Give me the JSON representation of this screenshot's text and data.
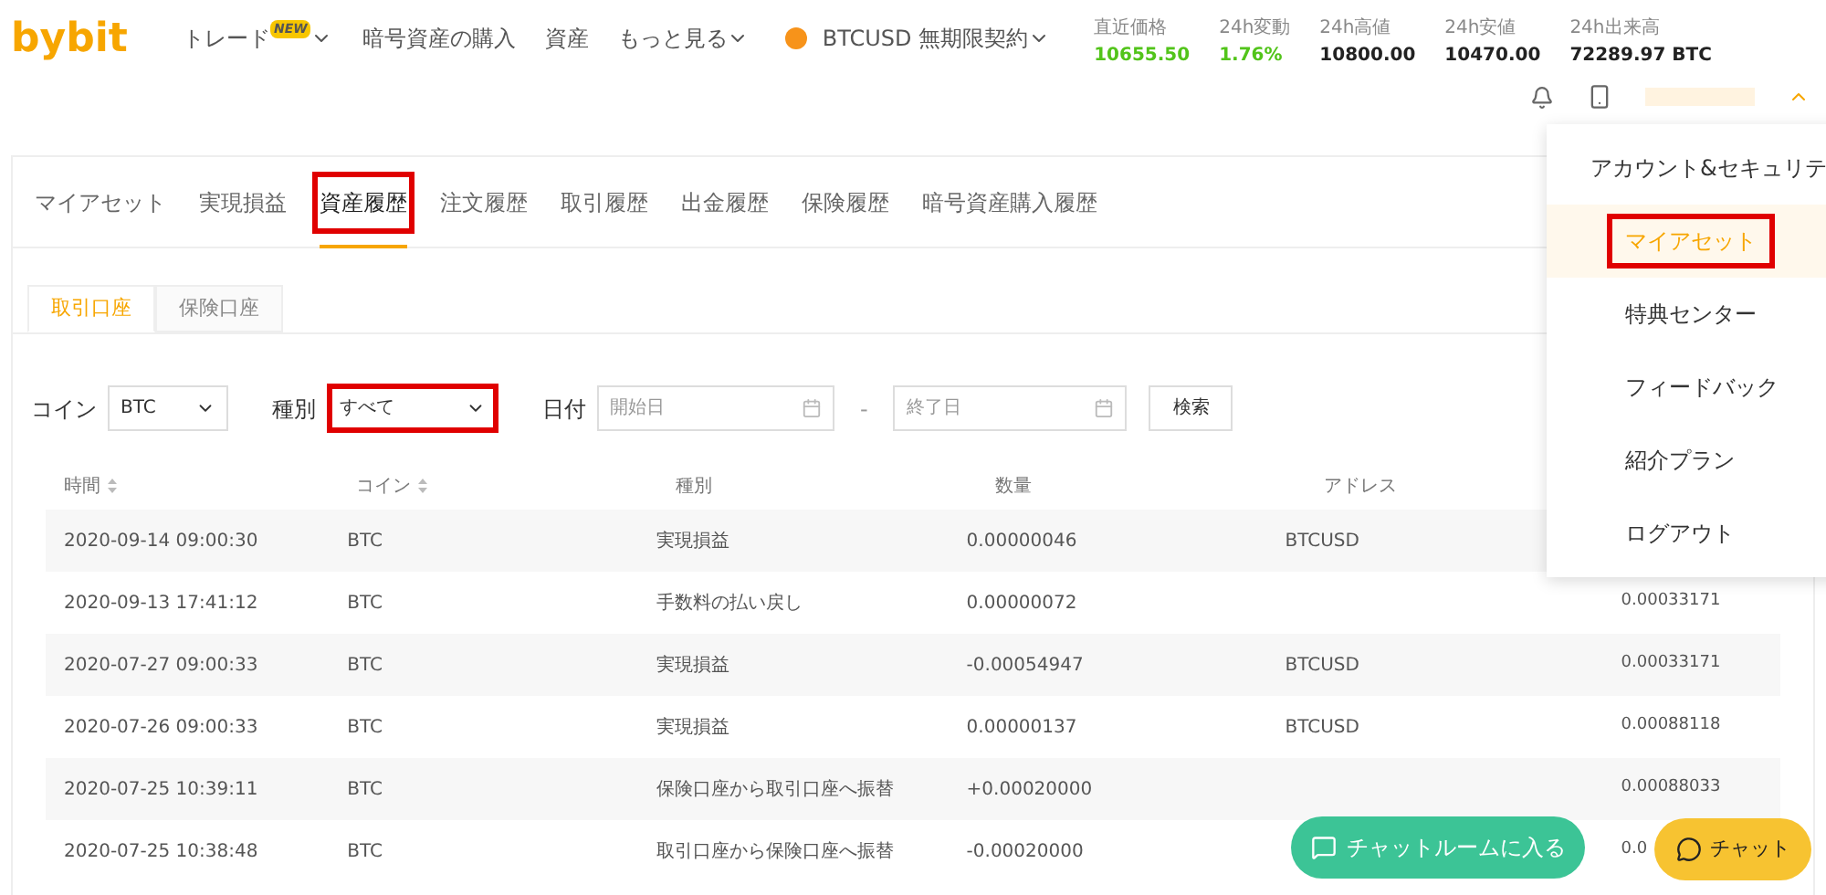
{
  "header": {
    "logo": "bybit",
    "nav": [
      {
        "label": "トレード",
        "badge": "NEW",
        "caret": true
      },
      {
        "label": "暗号資産の購入",
        "caret": false
      },
      {
        "label": "資産",
        "caret": false
      },
      {
        "label": "もっと見る",
        "caret": true
      }
    ],
    "contract": "BTCUSD 無期限契約",
    "stats": [
      {
        "label": "直近価格",
        "value": "10655.50",
        "color": "#52c41a"
      },
      {
        "label": "24h変動",
        "value": "1.76%",
        "color": "#52c41a"
      },
      {
        "label": "24h高値",
        "value": "10800.00",
        "color": "#222222"
      },
      {
        "label": "24h安値",
        "value": "10470.00",
        "color": "#222222"
      },
      {
        "label": "24h出来高",
        "value": "72289.97 BTC",
        "color": "#222222"
      }
    ]
  },
  "tabs": [
    {
      "label": "マイアセット",
      "selected": false,
      "highlighted": false
    },
    {
      "label": "実現損益",
      "selected": false,
      "highlighted": false
    },
    {
      "label": "資産履歴",
      "selected": true,
      "highlighted": true
    },
    {
      "label": "注文履歴",
      "selected": false,
      "highlighted": false
    },
    {
      "label": "取引履歴",
      "selected": false,
      "highlighted": false
    },
    {
      "label": "出金履歴",
      "selected": false,
      "highlighted": false
    },
    {
      "label": "保険履歴",
      "selected": false,
      "highlighted": false
    },
    {
      "label": "暗号資産購入履歴",
      "selected": false,
      "highlighted": false
    }
  ],
  "subtabs": [
    {
      "label": "取引口座",
      "selected": true
    },
    {
      "label": "保険口座",
      "selected": false
    }
  ],
  "filters": {
    "coin_label": "コイン",
    "coin": "BTC",
    "type_label": "種別",
    "type": "すべて",
    "type_highlighted": true,
    "date_label": "日付",
    "start_placeholder": "開始日",
    "separator": "-",
    "end_placeholder": "終了日",
    "search_button": "検索"
  },
  "table": {
    "columns": [
      {
        "label": "時間",
        "sortable": true
      },
      {
        "label": "コイン",
        "sortable": true
      },
      {
        "label": "種別",
        "sortable": false
      },
      {
        "label": "数量",
        "sortable": false
      },
      {
        "label": "アドレス",
        "sortable": false
      }
    ],
    "rows": [
      [
        "2020-09-14 09:00:30",
        "BTC",
        "実現損益",
        "0.00000046",
        "BTCUSD",
        ""
      ],
      [
        "2020-09-13 17:41:12",
        "BTC",
        "手数料の払い戻し",
        "0.00000072",
        "",
        "0.00033171"
      ],
      [
        "2020-07-27 09:00:33",
        "BTC",
        "実現損益",
        "-0.00054947",
        "BTCUSD",
        "0.00033171"
      ],
      [
        "2020-07-26 09:00:33",
        "BTC",
        "実現損益",
        "0.00000137",
        "BTCUSD",
        "0.00088118"
      ],
      [
        "2020-07-25 10:39:11",
        "BTC",
        "保険口座から取引口座へ振替",
        "+0.00020000",
        "",
        "0.00088033"
      ],
      [
        "2020-07-25 10:38:48",
        "BTC",
        "取引口座から保険口座へ振替",
        "-0.00020000",
        "",
        "0.0"
      ]
    ]
  },
  "user_menu": [
    {
      "label": "アカウント&セキュリテ",
      "selected": false,
      "highlighted": false
    },
    {
      "label": "マイアセット",
      "selected": true,
      "highlighted": true
    },
    {
      "label": "特典センター",
      "selected": false,
      "highlighted": false
    },
    {
      "label": "フィードバック",
      "selected": false,
      "highlighted": false
    },
    {
      "label": "紹介プラン",
      "selected": false,
      "highlighted": false
    },
    {
      "label": "ログアウト",
      "selected": false,
      "highlighted": false
    }
  ],
  "chat_room_button": "チャットルームに入る",
  "chat_button": "チャット"
}
